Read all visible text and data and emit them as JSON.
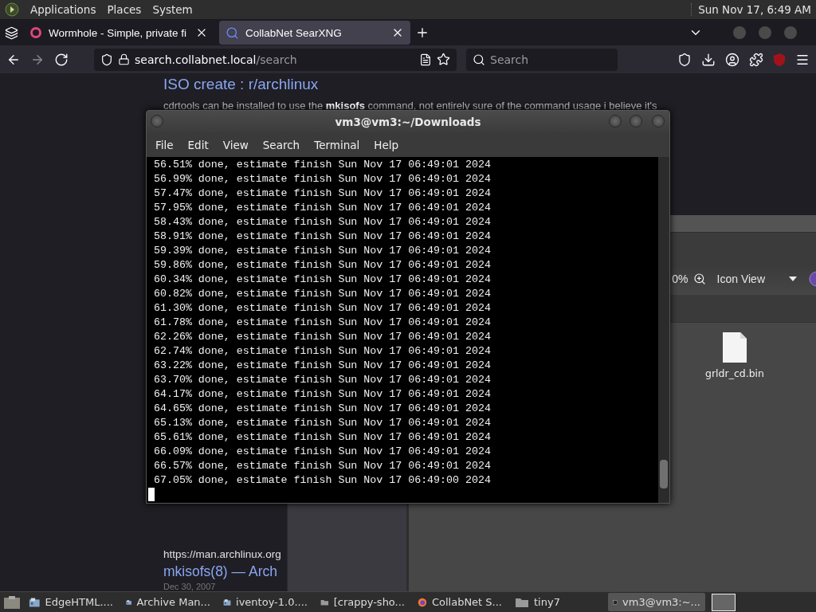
{
  "top_panel": {
    "menus": [
      "Applications",
      "Places",
      "System"
    ],
    "clock": "Sun Nov 17, 6:49 AM"
  },
  "browser": {
    "tabs": [
      {
        "title": "Wormhole - Simple, private fi",
        "kind": "wormhole",
        "selected": false
      },
      {
        "title": "CollabNet SearXNG",
        "kind": "search",
        "selected": true
      }
    ],
    "address": {
      "host": "search.collabnet.local",
      "path": "/search"
    },
    "search": {
      "placeholder": "Search"
    },
    "results": [
      {
        "title": "ISO create : r/archlinux",
        "snippet": "cdrtools can be installed to use the **mkisofs** command, not entirely sure of the command usage i believe it's"
      },
      {
        "url": "https://man.archlinux.org",
        "title": "mkisofs(8) — Arch",
        "date": "Dec 30, 2007"
      }
    ]
  },
  "file_manager": {
    "zoom": "0%",
    "view": "Icon View",
    "files": [
      {
        "name": "grldr_cd.bin"
      }
    ]
  },
  "terminal": {
    "title": "vm3@vm3:~/Downloads",
    "menus": [
      "File",
      "Edit",
      "View",
      "Search",
      "Terminal",
      "Help"
    ],
    "lines": [
      "56.51% done, estimate finish Sun Nov 17 06:49:01 2024",
      "56.99% done, estimate finish Sun Nov 17 06:49:01 2024",
      "57.47% done, estimate finish Sun Nov 17 06:49:01 2024",
      "57.95% done, estimate finish Sun Nov 17 06:49:01 2024",
      "58.43% done, estimate finish Sun Nov 17 06:49:01 2024",
      "58.91% done, estimate finish Sun Nov 17 06:49:01 2024",
      "59.39% done, estimate finish Sun Nov 17 06:49:01 2024",
      "59.86% done, estimate finish Sun Nov 17 06:49:01 2024",
      "60.34% done, estimate finish Sun Nov 17 06:49:01 2024",
      "60.82% done, estimate finish Sun Nov 17 06:49:01 2024",
      "61.30% done, estimate finish Sun Nov 17 06:49:01 2024",
      "61.78% done, estimate finish Sun Nov 17 06:49:01 2024",
      "62.26% done, estimate finish Sun Nov 17 06:49:01 2024",
      "62.74% done, estimate finish Sun Nov 17 06:49:01 2024",
      "63.22% done, estimate finish Sun Nov 17 06:49:01 2024",
      "63.70% done, estimate finish Sun Nov 17 06:49:01 2024",
      "64.17% done, estimate finish Sun Nov 17 06:49:01 2024",
      "64.65% done, estimate finish Sun Nov 17 06:49:01 2024",
      "65.13% done, estimate finish Sun Nov 17 06:49:01 2024",
      "65.61% done, estimate finish Sun Nov 17 06:49:01 2024",
      "66.09% done, estimate finish Sun Nov 17 06:49:01 2024",
      "66.57% done, estimate finish Sun Nov 17 06:49:01 2024",
      "67.05% done, estimate finish Sun Nov 17 06:49:00 2024"
    ]
  },
  "taskbar": {
    "items": [
      {
        "label": "EdgeHTML....",
        "kind": "archive",
        "selected": false
      },
      {
        "label": "Archive Man...",
        "kind": "archive",
        "selected": false
      },
      {
        "label": "iventoy-1.0....",
        "kind": "archive",
        "selected": false
      },
      {
        "label": "[crappy-sho...",
        "kind": "folder",
        "selected": false
      },
      {
        "label": "CollabNet S...",
        "kind": "browser",
        "selected": false
      },
      {
        "label": "tiny7",
        "kind": "folder",
        "selected": false
      },
      {
        "label": "vm3@vm3:~...",
        "kind": "terminal",
        "selected": true
      }
    ]
  }
}
